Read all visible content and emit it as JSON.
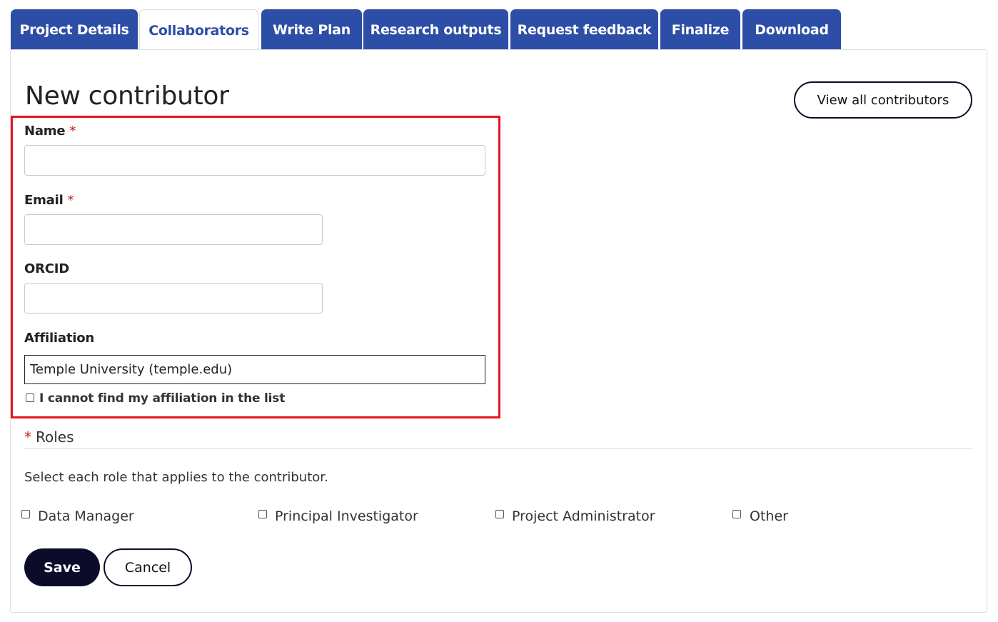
{
  "tabs": [
    {
      "label": "Project Details",
      "active": false
    },
    {
      "label": "Collaborators",
      "active": true
    },
    {
      "label": "Write Plan",
      "active": false
    },
    {
      "label": "Research outputs",
      "active": false
    },
    {
      "label": "Request feedback",
      "active": false
    },
    {
      "label": "Finalize",
      "active": false
    },
    {
      "label": "Download",
      "active": false
    }
  ],
  "page": {
    "title": "New contributor",
    "view_all_label": "View all contributors"
  },
  "form": {
    "name_label": "Name",
    "name_value": "",
    "email_label": "Email",
    "email_value": "",
    "orcid_label": "ORCID",
    "orcid_value": "",
    "affiliation_label": "Affiliation",
    "affiliation_value": "Temple University (temple.edu)",
    "no_affiliation_label": "I cannot find my affiliation in the list",
    "required_marker": "*"
  },
  "roles": {
    "legend": "Roles",
    "hint": "Select each role that applies to the contributor.",
    "options": [
      "Data Manager",
      "Principal Investigator",
      "Project Administrator",
      "Other"
    ]
  },
  "actions": {
    "save_label": "Save",
    "cancel_label": "Cancel"
  },
  "colors": {
    "tab_blue": "#2d4ea6",
    "button_dark": "#0c0c2a",
    "highlight_red": "#e8141c",
    "required_red": "#c02020"
  }
}
